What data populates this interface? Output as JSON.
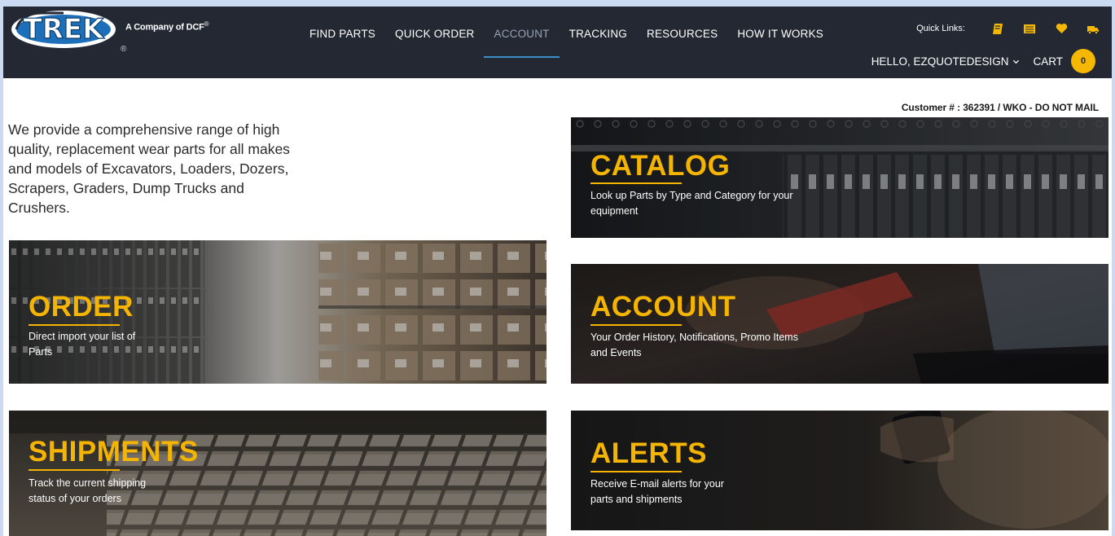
{
  "brand": {
    "logo_text": "TREK",
    "subtitle": "A Company of DCF",
    "subtitle_mark": "®",
    "reg_mark": "®"
  },
  "nav": [
    {
      "label": "FIND PARTS"
    },
    {
      "label": "QUICK ORDER"
    },
    {
      "label": "ACCOUNT",
      "active": true
    },
    {
      "label": "TRACKING"
    },
    {
      "label": "RESOURCES"
    },
    {
      "label": "HOW IT WORKS"
    }
  ],
  "quick_links": {
    "label": "Quick Links:",
    "icons": [
      "catalog-book-icon",
      "order-list-icon",
      "favorites-heart-icon",
      "shipping-truck-icon"
    ],
    "accent": "#f5b700"
  },
  "user": {
    "greeting": "HELLO, EZQUOTEDESIGN",
    "cart_label": "CART",
    "cart_count": "0"
  },
  "customer_line": "Customer # : 362391 / WKO - DO NOT MAIL",
  "intro_text": "We provide a comprehensive range of high quality, replacement wear parts for all makes and models of Excavators, Loaders, Dozers, Scrapers, Graders, Dump Trucks and Crushers.",
  "tiles": {
    "catalog": {
      "title": "CATALOG",
      "desc": "Look up Parts by Type and Category for your equipment"
    },
    "order": {
      "title": "ORDER",
      "desc": "Direct import your list of Parts"
    },
    "account": {
      "title": "ACCOUNT",
      "desc": "Your Order History, Notifications, Promo Items and Events"
    },
    "shipments": {
      "title": "SHIPMENTS",
      "desc": "Track the current shipping status of your orders"
    },
    "alerts": {
      "title": "ALERTS",
      "desc": "Receive E-mail alerts for your parts and shipments"
    }
  },
  "colors": {
    "header_bg": "#232833",
    "accent": "#f5b400",
    "page_bg": "#c9daf2"
  }
}
